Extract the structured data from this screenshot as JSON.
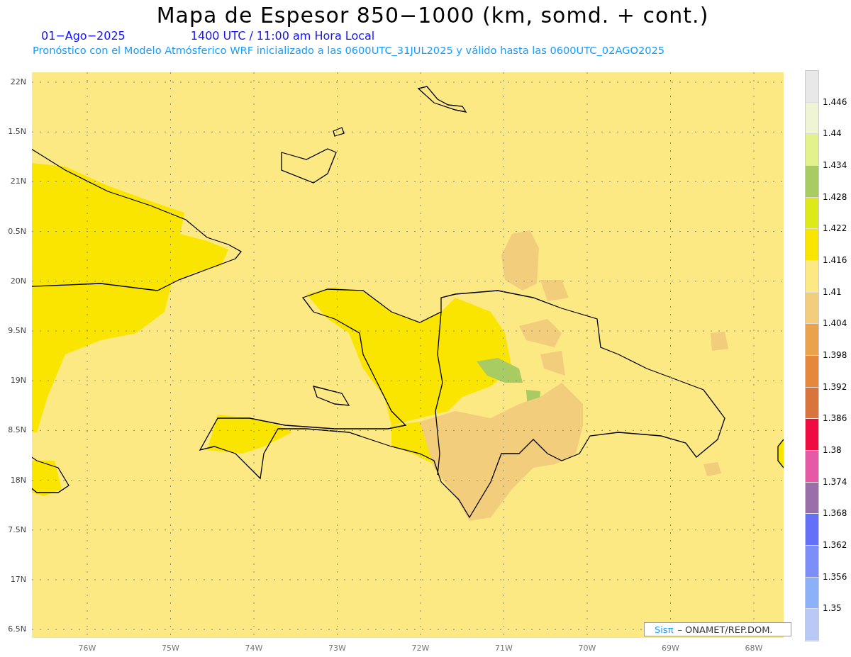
{
  "title": "Mapa de Espesor 850−1000 (km, somd. + cont.)",
  "date": "01−Ago−2025",
  "time": "1400 UTC / 11:00 am Hora Local",
  "forecast": "Pronóstico con el Modelo Atmósferico WRF inicializado a las 0600UTC_31JUL2025 y válido hasta las  0600UTC_02AGO2025",
  "y_ticks": [
    "22N",
    "1.5N",
    "21N",
    "0.5N",
    "20N",
    "9.5N",
    "19N",
    "8.5N",
    "18N",
    "7.5N",
    "17N",
    "6.5N"
  ],
  "x_ticks": [
    "76W",
    "75W",
    "74W",
    "73W",
    "72W",
    "71W",
    "70W",
    "69W",
    "68W"
  ],
  "colorbar": {
    "segments": [
      {
        "color": "#e8e8e8"
      },
      {
        "color": "#eff4d4"
      },
      {
        "color": "#e4f28c"
      },
      {
        "color": "#a8cc62"
      },
      {
        "color": "#dfe818"
      },
      {
        "color": "#fae500"
      },
      {
        "color": "#fce984"
      },
      {
        "color": "#f2cd7c"
      },
      {
        "color": "#eba24c"
      },
      {
        "color": "#e5883c"
      },
      {
        "color": "#d9753c"
      },
      {
        "color": "#ee0c40"
      },
      {
        "color": "#e659a6"
      },
      {
        "color": "#9a6ea8"
      },
      {
        "color": "#6470f8"
      },
      {
        "color": "#7c8ff8"
      },
      {
        "color": "#8cb1f8"
      },
      {
        "color": "#b8c9f8"
      }
    ],
    "labels": [
      "1.446",
      "1.44",
      "1.434",
      "1.428",
      "1.422",
      "1.416",
      "1.41",
      "1.404",
      "1.398",
      "1.392",
      "1.386",
      "1.38",
      "1.374",
      "1.368",
      "1.362",
      "1.356",
      "1.35"
    ]
  },
  "credit": {
    "logo": "Sisπ",
    "text": "– ONAMET/REP.DOM."
  }
}
